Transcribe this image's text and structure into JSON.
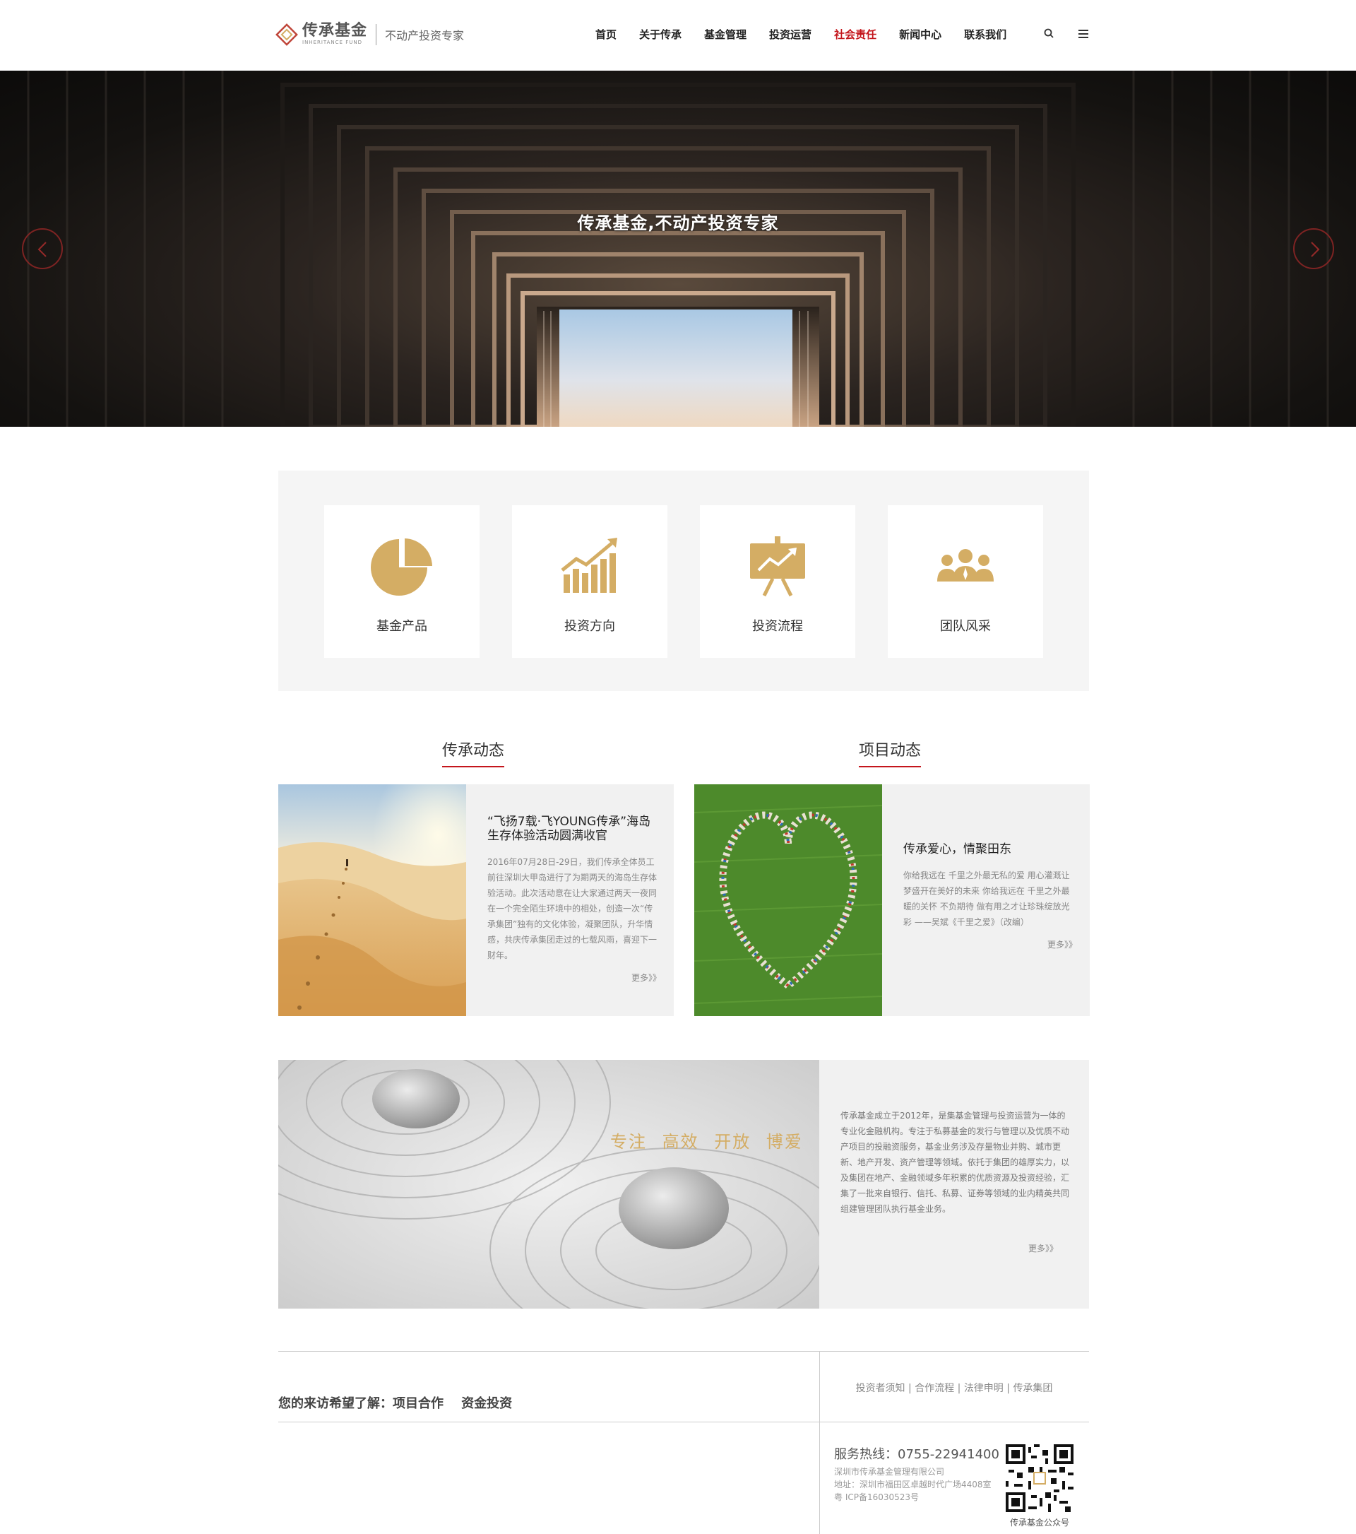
{
  "header": {
    "logo_cn": "传承基金",
    "logo_en": "INHERITANCE FUND",
    "slogan": "不动产投资专家",
    "nav": [
      "首页",
      "关于传承",
      "基金管理",
      "投资运营",
      "社会责任",
      "新闻中心",
      "联系我们"
    ],
    "active_nav": "社会责任"
  },
  "banner": {
    "title": "传承基金,不动产投资专家"
  },
  "features": [
    {
      "label": "基金产品",
      "icon": "pie-chart-icon"
    },
    {
      "label": "投资方向",
      "icon": "growth-chart-icon"
    },
    {
      "label": "投资流程",
      "icon": "presentation-board-icon"
    },
    {
      "label": "团队风采",
      "icon": "team-icon"
    }
  ],
  "news_left": {
    "section_title": "传承动态",
    "title": "“飞扬7载·飞YOUNG传承”海岛生存体验活动圆满收官",
    "body": "2016年07月28日-29日，我们传承全体员工前往深圳大甲岛进行了为期两天的海岛生存体验活动。此次活动意在让大家通过两天一夜同在一个完全陌生环境中的相处，创造一次“传承集团”独有的文化体验，凝聚团队，升华情感，共庆传承集团走过的七载风雨，喜迎下一财年。",
    "more": "更多》》"
  },
  "news_right": {
    "section_title": "项目动态",
    "title": "传承爱心，情聚田东",
    "body": "你给我远在 千里之外最无私的爱 用心灌溉让梦盛开在美好的未来 你给我远在 千里之外最暖的关怀 不负期待 做有用之才让珍珠绽放光彩 ——吴斌《千里之爱》（改编）",
    "more": "更多》》"
  },
  "about": {
    "slogan": "专注 高效 开放 博爱",
    "text": "传承基金成立于2012年，是集基金管理与投资运营为一体的专业化金融机构。专注于私募基金的发行与管理以及优质不动产项目的投融资服务，基金业务涉及存量物业并购、城市更新、地产开发、资产管理等领域。依托于集团的雄厚实力，以及集团在地产、金融领域多年积累的优质资源及投资经验，汇集了一批来自银行、信托、私募、证券等领域的业内精英共同组建管理团队执行基金业务。",
    "more": "更多》》"
  },
  "footer": {
    "visit_prefix": "您的来访希望了解：",
    "visit_links": [
      "项目合作",
      "资金投资"
    ],
    "links": [
      "投资者须知",
      "合作流程",
      "法律申明",
      "传承集团"
    ],
    "hotline": "服务热线：0755-22941400",
    "company": "深圳市传承基金管理有限公司",
    "address": "地址：深圳市福田区卓越时代广场4408室",
    "icp": "粤 ICP备16030523号",
    "qr_label": "传承基金公众号"
  },
  "colors": {
    "accent_red": "#c4161c",
    "icon_gold": "#d4ad64"
  }
}
